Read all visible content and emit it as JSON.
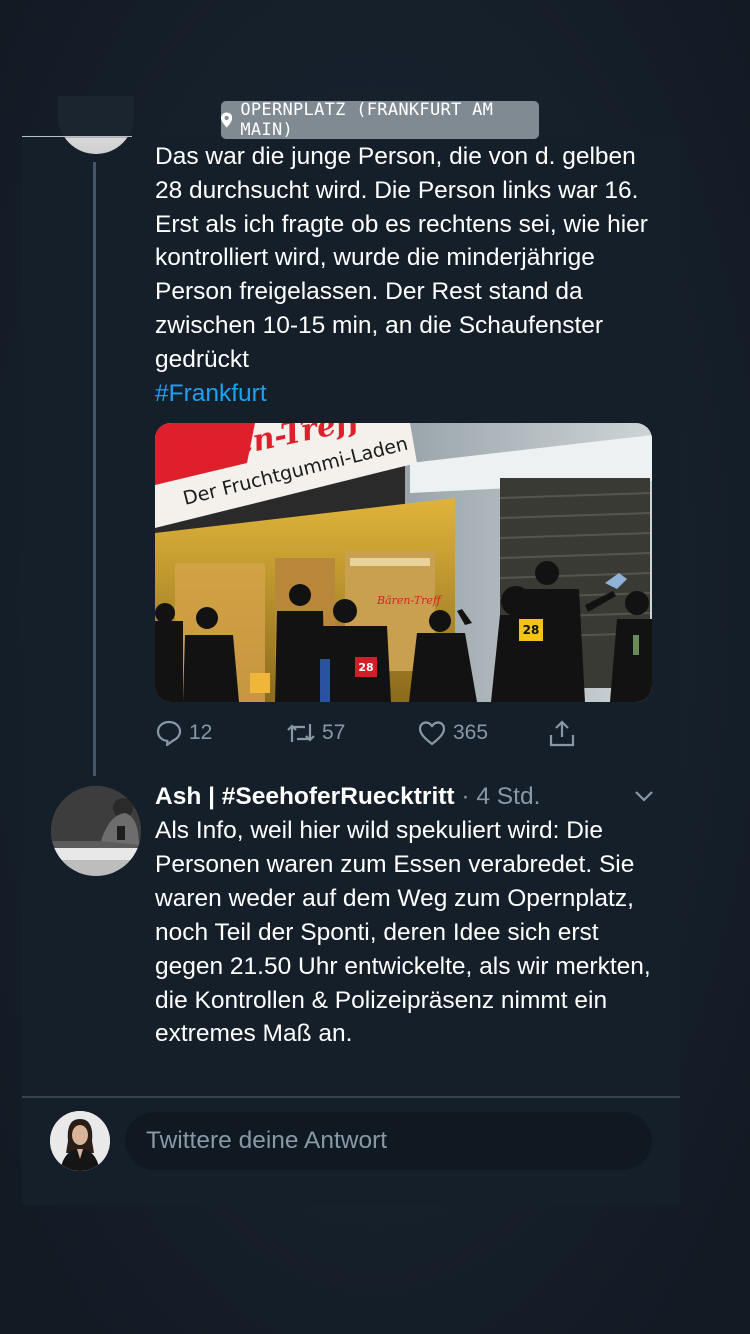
{
  "story": {
    "location_sticker": "OPERNPLATZ (FRANKFURT AM MAIN)",
    "location_icon": "pin-icon"
  },
  "tweet": {
    "text": "Das war die junge Person, die von d. gelben 28 durchsucht wird. Die Person links war 16. Erst als ich fragte ob es rechtens sei, wie hier kontrolliert wird, wurde die minderjährige Person freigelassen. Der Rest stand da zwischen 10-15 min, an die Schaufenster gedrückt",
    "hashtag": "#Frankfurt",
    "media": {
      "shop_sign_main": "Bären-Treff",
      "shop_sign_sub": "Der Fruchtgummi-Laden",
      "window_sign": "Bären-Treff",
      "badge_left": "28",
      "badge_right": "28"
    },
    "actions": {
      "replies": "12",
      "retweets": "57",
      "likes": "365"
    }
  },
  "reply": {
    "author": "Ash | #SeehoferRuecktritt",
    "separator": "·",
    "time": "4 Std.",
    "text": "Als Info, weil hier wild spekuliert wird: Die Personen waren zum Essen verabredet. Sie waren weder auf dem Weg zum Opernplatz, noch Teil der Sponti, deren Idee sich erst gegen 21.50 Uhr entwickelte, als wir merkten, die Kontrollen & Polizeipräsenz nimmt ein extremes Maß an."
  },
  "compose": {
    "placeholder": "Twittere deine Antwort"
  },
  "colors": {
    "background": "#141d26",
    "accent": "#1da1f2",
    "muted": "#8899a6"
  }
}
